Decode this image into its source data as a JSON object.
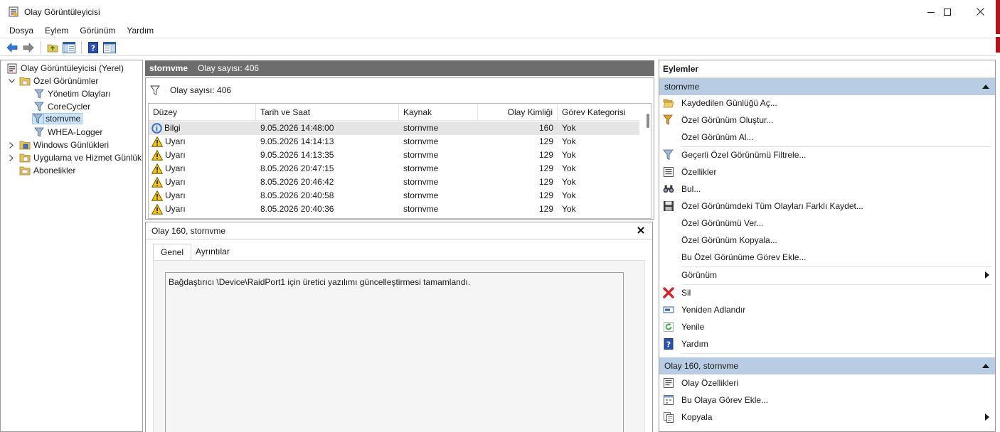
{
  "window": {
    "title": "Olay Görüntüleyicisi"
  },
  "menubar": {
    "items": [
      "Dosya",
      "Eylem",
      "Görünüm",
      "Yardım"
    ]
  },
  "tree": {
    "root": "Olay Görüntüleyicisi (Yerel)",
    "custom_views": "Özel Görünümler",
    "admin_events": "Yönetim Olayları",
    "corecycler": "CoreCycler",
    "stornvme": "stornvme",
    "whea": "WHEA-Logger",
    "windows_logs": "Windows Günlükleri",
    "app_services": "Uygulama ve Hizmet Günlükleri",
    "subscriptions": "Abonelikler"
  },
  "center": {
    "view_name": "stornvme",
    "event_count_header": "Olay sayısı: 406",
    "filter_text": "Olay sayısı: 406",
    "columns": [
      "Düzey",
      "Tarih ve Saat",
      "Kaynak",
      "Olay Kimliği",
      "Görev Kategorisi"
    ],
    "rows": [
      {
        "level": "Bilgi",
        "icon": "info-icon",
        "datetime": "9.05.2026 14:48:00",
        "source": "stornvme",
        "id": "160",
        "category": "Yok"
      },
      {
        "level": "Uyarı",
        "icon": "warning-icon",
        "datetime": "9.05.2026 14:14:13",
        "source": "stornvme",
        "id": "129",
        "category": "Yok"
      },
      {
        "level": "Uyarı",
        "icon": "warning-icon",
        "datetime": "9.05.2026 14:13:35",
        "source": "stornvme",
        "id": "129",
        "category": "Yok"
      },
      {
        "level": "Uyarı",
        "icon": "warning-icon",
        "datetime": "8.05.2026 20:47:15",
        "source": "stornvme",
        "id": "129",
        "category": "Yok"
      },
      {
        "level": "Uyarı",
        "icon": "warning-icon",
        "datetime": "8.05.2026 20:46:42",
        "source": "stornvme",
        "id": "129",
        "category": "Yok"
      },
      {
        "level": "Uyarı",
        "icon": "warning-icon",
        "datetime": "8.05.2026 20:40:58",
        "source": "stornvme",
        "id": "129",
        "category": "Yok"
      },
      {
        "level": "Uyarı",
        "icon": "warning-icon",
        "datetime": "8.05.2026 20:40:36",
        "source": "stornvme",
        "id": "129",
        "category": "Yok"
      }
    ]
  },
  "detail": {
    "title": "Olay 160, stornvme",
    "tabs": [
      "Genel",
      "Ayrıntılar"
    ],
    "message": "Bağdaştırıcı \\Device\\RaidPort1 için üretici yazılımı güncelleştirmesi tamamlandı."
  },
  "actions": {
    "title": "Eylemler",
    "section1": "stornvme",
    "items1": [
      {
        "label": "Kaydedilen Günlüğü Aç...",
        "icon": "folder-open-icon"
      },
      {
        "label": "Özel Görünüm Oluştur...",
        "icon": "filter-create-icon"
      },
      {
        "label": "Özel Görünüm Al...",
        "icon": ""
      },
      {
        "label": "Geçerli Özel Görünümü Filtrele...",
        "icon": "filter-icon"
      },
      {
        "label": "Özellikler",
        "icon": "properties-icon"
      },
      {
        "label": "Bul...",
        "icon": "binoculars-icon"
      },
      {
        "label": "Özel Görünümdeki Tüm Olayları Farklı Kaydet...",
        "icon": "save-icon"
      },
      {
        "label": "Özel Görünümü Ver...",
        "icon": ""
      },
      {
        "label": "Özel Görünüm Kopyala...",
        "icon": ""
      },
      {
        "label": "Bu Özel Görünüme Görev Ekle...",
        "icon": ""
      },
      {
        "label": "Görünüm",
        "icon": ""
      },
      {
        "label": "Sil",
        "icon": "delete-icon"
      },
      {
        "label": "Yeniden Adlandır",
        "icon": "rename-icon"
      },
      {
        "label": "Yenile",
        "icon": "refresh-icon"
      },
      {
        "label": "Yardım",
        "icon": "help-icon"
      }
    ],
    "section2": "Olay 160, stornvme",
    "items2": [
      {
        "label": "Olay Özellikleri",
        "icon": "event-properties-icon"
      },
      {
        "label": "Bu Olaya Görev Ekle...",
        "icon": "task-add-icon"
      },
      {
        "label": "Kopyala",
        "icon": "copy-icon"
      }
    ]
  },
  "colors": {
    "section_header": "#b8cde4",
    "center_header": "#6d6d6d",
    "accent_red": "#b2141b"
  }
}
